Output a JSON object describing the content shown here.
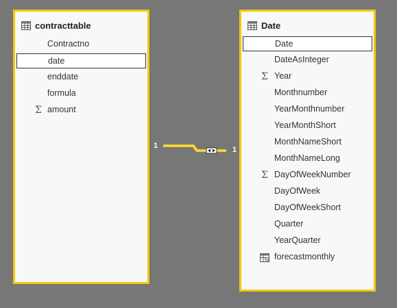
{
  "tables": {
    "left": {
      "title": "contracttable",
      "fields": [
        {
          "label": "Contractno",
          "icon": "none",
          "selected": false
        },
        {
          "label": "date",
          "icon": "none",
          "selected": true
        },
        {
          "label": "enddate",
          "icon": "none",
          "selected": false
        },
        {
          "label": "formula",
          "icon": "none",
          "selected": false
        },
        {
          "label": "amount",
          "icon": "sigma-icon",
          "selected": false
        }
      ]
    },
    "right": {
      "title": "Date",
      "fields": [
        {
          "label": "Date",
          "icon": "none",
          "selected": true
        },
        {
          "label": "DateAsInteger",
          "icon": "none",
          "selected": false
        },
        {
          "label": "Year",
          "icon": "sigma-icon",
          "selected": false
        },
        {
          "label": "Monthnumber",
          "icon": "none",
          "selected": false
        },
        {
          "label": "YearMonthnumber",
          "icon": "none",
          "selected": false
        },
        {
          "label": "YearMonthShort",
          "icon": "none",
          "selected": false
        },
        {
          "label": "MonthNameShort",
          "icon": "none",
          "selected": false
        },
        {
          "label": "MonthNameLong",
          "icon": "none",
          "selected": false
        },
        {
          "label": "DayOfWeekNumber",
          "icon": "sigma-icon",
          "selected": false
        },
        {
          "label": "DayOfWeek",
          "icon": "none",
          "selected": false
        },
        {
          "label": "DayOfWeekShort",
          "icon": "none",
          "selected": false
        },
        {
          "label": "Quarter",
          "icon": "none",
          "selected": false
        },
        {
          "label": "YearQuarter",
          "icon": "none",
          "selected": false
        },
        {
          "label": "forecastmonthly",
          "icon": "calculated-table-icon",
          "selected": false
        }
      ]
    }
  },
  "relationship": {
    "left_cardinality": "1",
    "right_cardinality": "1",
    "filter_direction": "both"
  },
  "colors": {
    "background": "#777777",
    "card_border": "#f2c80f",
    "card_background": "#f8f8f8"
  }
}
